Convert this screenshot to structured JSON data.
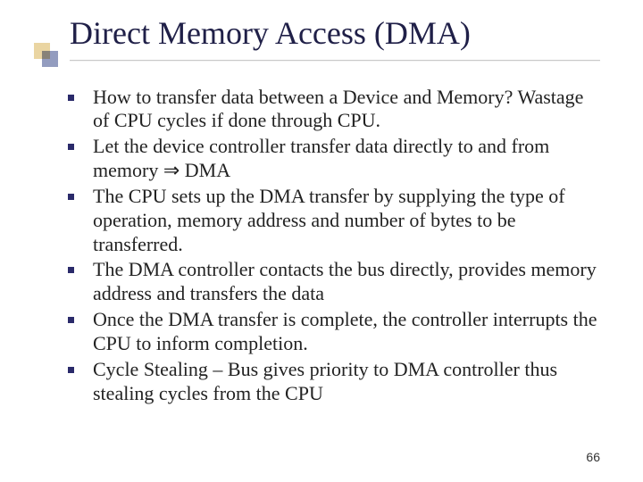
{
  "title": "Direct Memory Access (DMA)",
  "bullets": [
    "How to transfer data between a Device and Memory? Wastage of CPU cycles if done through CPU.",
    "Let the device controller transfer data directly to and from memory ⇒ DMA",
    "The CPU sets up the DMA transfer by supplying the type of operation, memory address and number of bytes to be transferred.",
    "The DMA controller contacts the bus directly, provides memory address and transfers the data",
    "Once the DMA transfer is complete, the controller interrupts the CPU to inform completion.",
    "Cycle Stealing – Bus gives priority to DMA controller thus stealing cycles from the CPU"
  ],
  "page_number": "66"
}
